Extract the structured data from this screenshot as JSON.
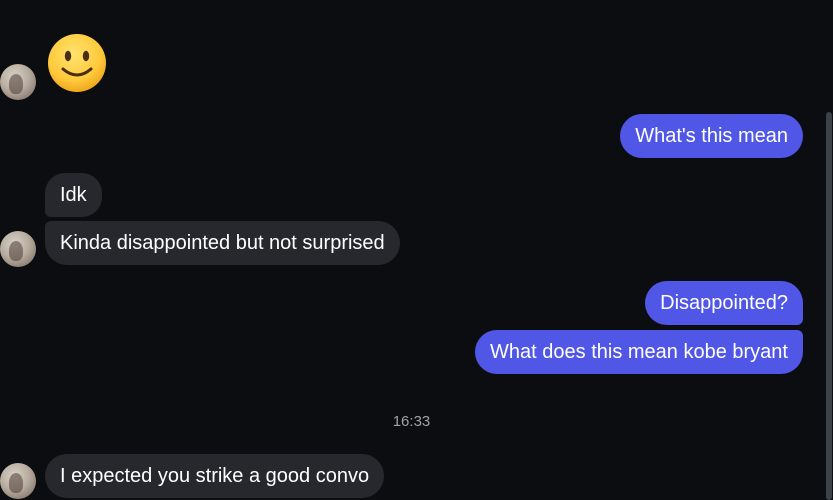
{
  "messages": [
    {
      "id": "emoji-smile",
      "direction": "incoming",
      "type": "emoji",
      "emoji": "slightly-smiling-face"
    },
    {
      "id": "m1",
      "direction": "outgoing",
      "text": "What's this mean"
    },
    {
      "id": "m2",
      "direction": "incoming",
      "text": "Idk"
    },
    {
      "id": "m3",
      "direction": "incoming",
      "text": "Kinda disappointed but not surprised"
    },
    {
      "id": "m4",
      "direction": "outgoing",
      "text": "Disappointed?"
    },
    {
      "id": "m5",
      "direction": "outgoing",
      "text": "What does this mean kobe bryant"
    },
    {
      "id": "m6",
      "direction": "incoming",
      "text": "I expected you strike a good convo"
    }
  ],
  "timestamp": "16:33",
  "colors": {
    "background": "#0b0d10",
    "incoming_bubble": "#26282d",
    "outgoing_bubble": "#5057e6",
    "timestamp_text": "#9ea3ab"
  },
  "icons": {
    "avatar": "contact-avatar",
    "emoji": "slightly-smiling-face"
  }
}
